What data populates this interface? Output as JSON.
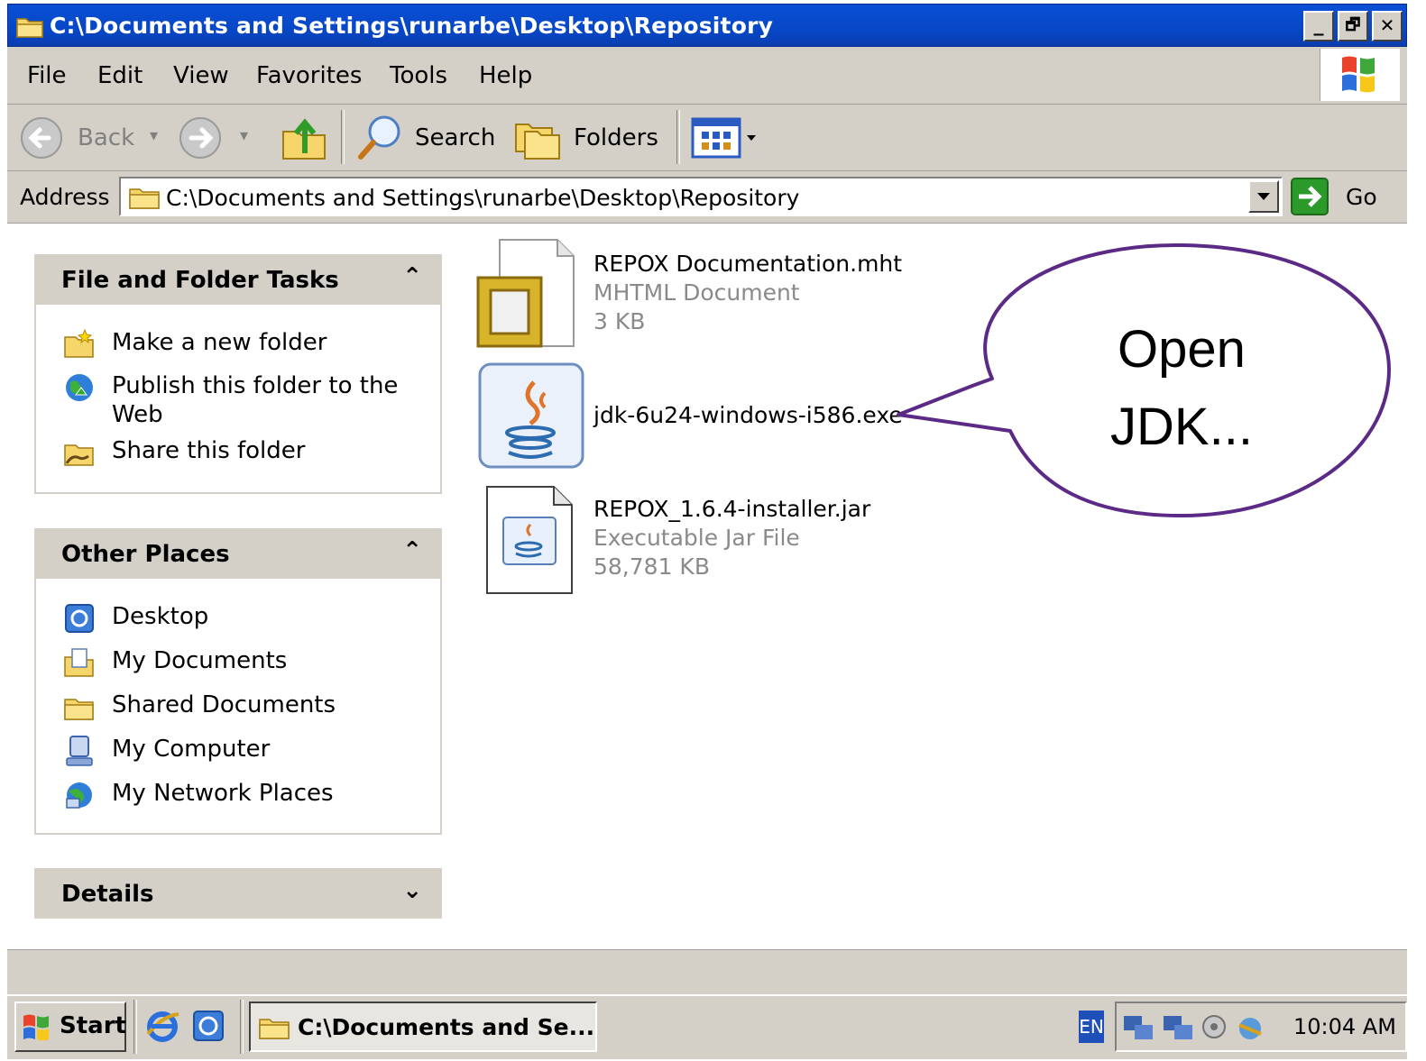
{
  "window": {
    "title": "C:\\Documents and Settings\\runarbe\\Desktop\\Repository",
    "controls": {
      "minimize": "_",
      "maximize": "🗗",
      "close": "✕"
    }
  },
  "menu": {
    "items": [
      "File",
      "Edit",
      "View",
      "Favorites",
      "Tools",
      "Help"
    ]
  },
  "toolbar": {
    "back_label": "Back",
    "search_label": "Search",
    "folders_label": "Folders"
  },
  "address": {
    "label": "Address",
    "value": "C:\\Documents and Settings\\runarbe\\Desktop\\Repository",
    "go_label": "Go"
  },
  "tasks_panel": {
    "file_folder_tasks": {
      "title": "File and Folder Tasks",
      "collapse_glyph": "⌃",
      "items": [
        "Make a new folder",
        "Publish this folder to the Web",
        "Share this folder"
      ]
    },
    "other_places": {
      "title": "Other Places",
      "collapse_glyph": "⌃",
      "items": [
        "Desktop",
        "My Documents",
        "Shared Documents",
        "My Computer",
        "My Network Places"
      ]
    },
    "details": {
      "title": "Details",
      "expand_glyph": "⌄"
    }
  },
  "files": [
    {
      "name": "REPOX Documentation.mht",
      "type": "MHTML Document",
      "size": "3 KB",
      "icon": "mht-file-icon"
    },
    {
      "name": "jdk-6u24-windows-i586.exe",
      "type": "",
      "size": "",
      "icon": "java-installer-icon"
    },
    {
      "name": "REPOX_1.6.4-installer.jar",
      "type": "Executable Jar File",
      "size": "58,781 KB",
      "icon": "jar-file-icon"
    }
  ],
  "callout": {
    "line1": "Open",
    "line2": "JDK...",
    "stroke_color": "#5b2a86"
  },
  "taskbar": {
    "start_label": "Start",
    "active_window": "C:\\Documents and Se...",
    "language": "EN",
    "clock": "10:04 AM"
  }
}
